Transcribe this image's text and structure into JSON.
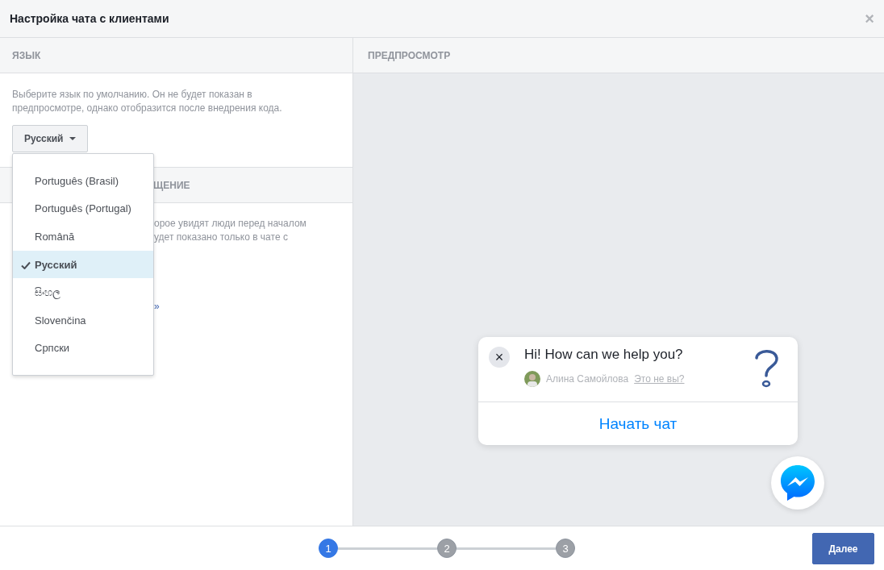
{
  "window": {
    "title": "Настройка чата с клиентами",
    "close": "×"
  },
  "language_panel": {
    "header": "ЯЗЫК",
    "description": "Выберите язык по умолчанию. Он не будет показан в предпросмотре, однако отобразится после внедрения кода.",
    "dropdown": {
      "value": "Русский",
      "expanded": true,
      "options": [
        {
          "label": "Português (Brasil)",
          "selected": false
        },
        {
          "label": "Português (Portugal)",
          "selected": false
        },
        {
          "label": "Română",
          "selected": false
        },
        {
          "label": "Русский",
          "selected": true
        },
        {
          "label": "සිංහල",
          "selected": false
        },
        {
          "label": "Slovenčina",
          "selected": false
        },
        {
          "label": "Српски",
          "selected": false
        }
      ]
    }
  },
  "greeting_panel": {
    "header": "ЩЕНИЕ",
    "lines": [
      "орое увидят люди перед началом",
      "удет показано только в чате с"
    ],
    "link": "»"
  },
  "preview_panel": {
    "header": "ПРЕДПРОСМОТР",
    "chat": {
      "close": "×",
      "greeting": "Hi! How can we help you?",
      "user_name": "Алина Самойлова",
      "not_you_link": "Это не вы?",
      "start_button": "Начать чат"
    }
  },
  "footer": {
    "steps": [
      {
        "label": "1",
        "selected": true
      },
      {
        "label": "2",
        "selected": false
      },
      {
        "label": "3",
        "selected": false
      }
    ],
    "next_button": "Далее"
  }
}
